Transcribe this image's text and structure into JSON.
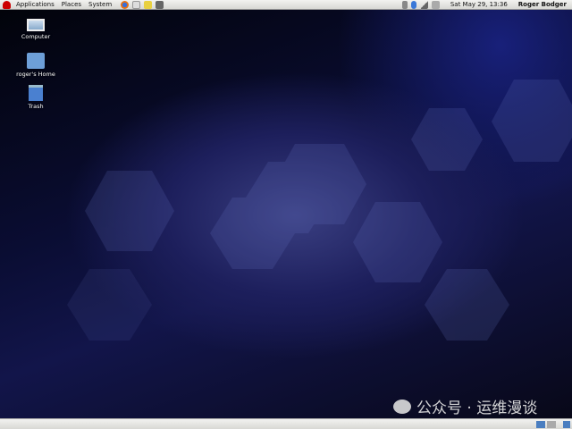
{
  "top_panel": {
    "menus": [
      "Applications",
      "Places",
      "System"
    ],
    "clock": "Sat May 29, 13:36",
    "user": "Roger Bodger"
  },
  "desktop_icons": [
    {
      "label": "Computer"
    },
    {
      "label": "roger's Home"
    },
    {
      "label": "Trash"
    }
  ],
  "watermark": "公众号 · 运维漫谈",
  "colors": {
    "panel": "#e4e4e2",
    "desktop": "#0a0d33"
  }
}
